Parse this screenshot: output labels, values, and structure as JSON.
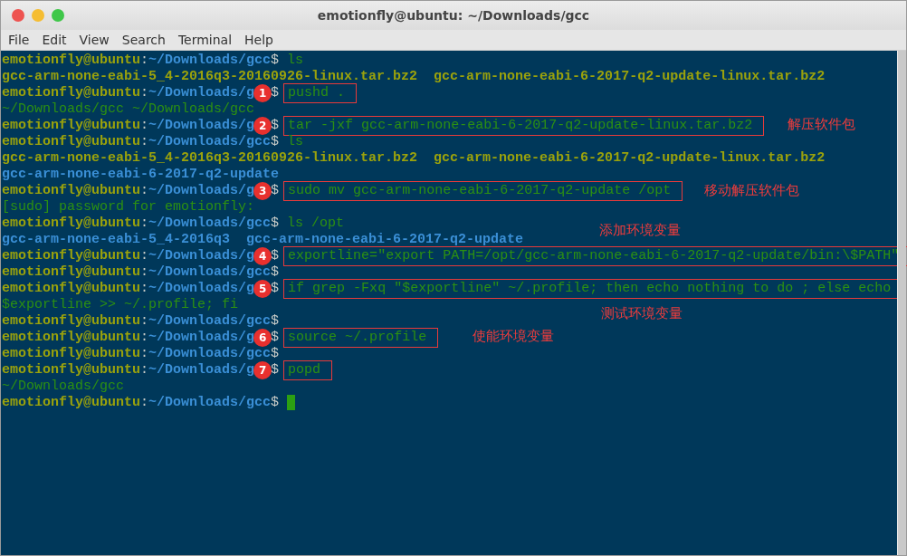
{
  "window": {
    "title": "emotionfly@ubuntu: ~/Downloads/gcc"
  },
  "menu": [
    "File",
    "Edit",
    "View",
    "Search",
    "Terminal",
    "Help"
  ],
  "lines": [
    {
      "kind": "prompt",
      "user": "emotionfly@ubuntu",
      "colon": ":",
      "path": "~/Downloads/gcc",
      "dollar": "$",
      "command": "ls"
    },
    {
      "kind": "output",
      "parts": [
        {
          "kind": "archive",
          "text": "gcc-arm-none-eabi-5_4-2016q3-20160926-linux.tar.bz2"
        },
        {
          "kind": "archive",
          "text": "gcc-arm-none-eabi-6-2017-q2-update-linux.tar.bz2"
        }
      ]
    },
    {
      "kind": "prompt",
      "user": "emotionfly@ubuntu",
      "colon": ":",
      "path": "~/Downloads/g",
      "badge": "1",
      "dollar": "$",
      "command": "pushd .",
      "boxed": true
    },
    {
      "kind": "output",
      "parts": [
        {
          "kind": "plain",
          "text": "~/Downloads/gcc ~/Downloads/gcc"
        }
      ]
    },
    {
      "kind": "prompt",
      "user": "emotionfly@ubuntu",
      "colon": ":",
      "path": "~/Downloads/g",
      "badge": "2",
      "dollar": "$",
      "command": "tar -jxf gcc-arm-none-eabi-6-2017-q2-update-linux.tar.bz2",
      "boxed": true
    },
    {
      "kind": "prompt",
      "user": "emotionfly@ubuntu",
      "colon": ":",
      "path": "~/Downloads/gcc",
      "dollar": "$",
      "command": "ls"
    },
    {
      "kind": "output",
      "parts": [
        {
          "kind": "archive",
          "text": "gcc-arm-none-eabi-5_4-2016q3-20160926-linux.tar.bz2"
        },
        {
          "kind": "archive",
          "text": "gcc-arm-none-eabi-6-2017-q2-update-linux.tar.bz2"
        }
      ]
    },
    {
      "kind": "output",
      "parts": [
        {
          "kind": "dir",
          "text": "gcc-arm-none-eabi-6-2017-q2-update"
        }
      ]
    },
    {
      "kind": "prompt",
      "user": "emotionfly@ubuntu",
      "colon": ":",
      "path": "~/Downloads/g",
      "badge": "3",
      "dollar": "$",
      "command": "sudo mv gcc-arm-none-eabi-6-2017-q2-update /opt",
      "boxed": true
    },
    {
      "kind": "output",
      "parts": [
        {
          "kind": "plain",
          "text": "[sudo] password for emotionfly:"
        }
      ]
    },
    {
      "kind": "prompt",
      "user": "emotionfly@ubuntu",
      "colon": ":",
      "path": "~/Downloads/gcc",
      "dollar": "$",
      "command": "ls /opt"
    },
    {
      "kind": "output",
      "parts": [
        {
          "kind": "dir",
          "text": "gcc-arm-none-eabi-5_4-2016q3"
        },
        {
          "kind": "dir",
          "text": "gcc-arm-none-eabi-6-2017-q2-update"
        }
      ]
    },
    {
      "kind": "prompt",
      "user": "emotionfly@ubuntu",
      "colon": ":",
      "path": "~/Downloads/g",
      "badge": "4",
      "dollar": "$",
      "command": "exportline=\"export PATH=/opt/gcc-arm-none-eabi-6-2017-q2-update/bin:\\$PATH\"",
      "boxed": true
    },
    {
      "kind": "prompt",
      "user": "emotionfly@ubuntu",
      "colon": ":",
      "path": "~/Downloads/gcc",
      "dollar": "$"
    },
    {
      "kind": "prompt",
      "user": "emotionfly@ubuntu",
      "colon": ":",
      "path": "~/Downloads/g",
      "badge": "5",
      "dollar": "$",
      "command": "if grep -Fxq \"$exportline\" ~/.profile; then echo nothing to do ; else echo",
      "boxed": true
    },
    {
      "kind": "output",
      "parts": [
        {
          "kind": "plain",
          "text": "$exportline >> ~/.profile; fi"
        }
      ]
    },
    {
      "kind": "prompt",
      "user": "emotionfly@ubuntu",
      "colon": ":",
      "path": "~/Downloads/gcc",
      "dollar": "$"
    },
    {
      "kind": "prompt",
      "user": "emotionfly@ubuntu",
      "colon": ":",
      "path": "~/Downloads/g",
      "badge": "6",
      "dollar": "$",
      "command": "source ~/.profile",
      "boxed": true
    },
    {
      "kind": "prompt",
      "user": "emotionfly@ubuntu",
      "colon": ":",
      "path": "~/Downloads/gcc",
      "dollar": "$"
    },
    {
      "kind": "prompt",
      "user": "emotionfly@ubuntu",
      "colon": ":",
      "path": "~/Downloads/g",
      "badge": "7",
      "dollar": "$",
      "command": "popd",
      "boxed": true
    },
    {
      "kind": "output",
      "parts": [
        {
          "kind": "plain",
          "text": "~/Downloads/gcc"
        }
      ]
    },
    {
      "kind": "prompt",
      "user": "emotionfly@ubuntu",
      "colon": ":",
      "path": "~/Downloads/gcc",
      "dollar": "$",
      "cursor": true
    }
  ],
  "notes": [
    "解压软件包",
    "移动解压软件包",
    "添加环境变量",
    "测试环境变量",
    "使能环境变量"
  ]
}
